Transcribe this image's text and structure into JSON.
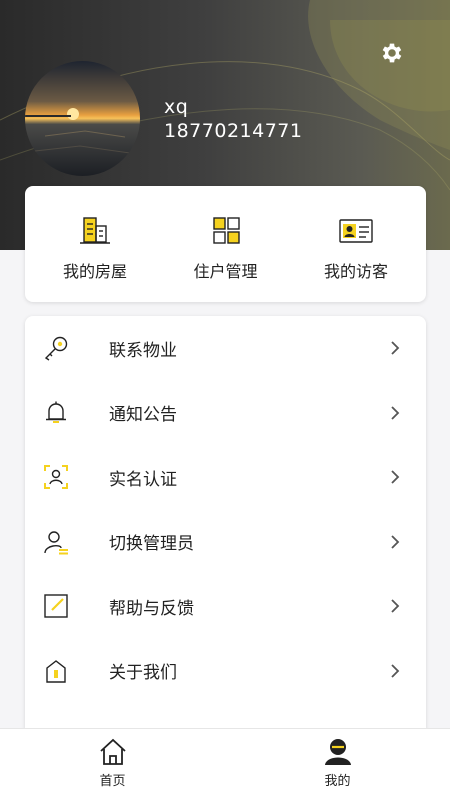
{
  "user": {
    "name": "xq",
    "phone": "18770214771"
  },
  "header": {
    "settings_icon": "gear-icon"
  },
  "quick_actions": [
    {
      "label": "我的房屋",
      "icon": "building-icon"
    },
    {
      "label": "住户管理",
      "icon": "grid-icon"
    },
    {
      "label": "我的访客",
      "icon": "id-card-icon"
    }
  ],
  "menu": [
    {
      "label": "联系物业",
      "icon": "key-icon"
    },
    {
      "label": "通知公告",
      "icon": "bell-icon"
    },
    {
      "label": "实名认证",
      "icon": "face-scan-icon"
    },
    {
      "label": "切换管理员",
      "icon": "switch-user-icon"
    },
    {
      "label": "帮助与反馈",
      "icon": "edit-icon"
    },
    {
      "label": "关于我们",
      "icon": "home-badge-icon"
    }
  ],
  "tabbar": [
    {
      "label": "首页",
      "icon": "home-icon"
    },
    {
      "label": "我的",
      "icon": "profile-icon"
    }
  ],
  "colors": {
    "accent": "#f5d21f",
    "header_dark": "#2a2a2a",
    "text": "#222222"
  }
}
